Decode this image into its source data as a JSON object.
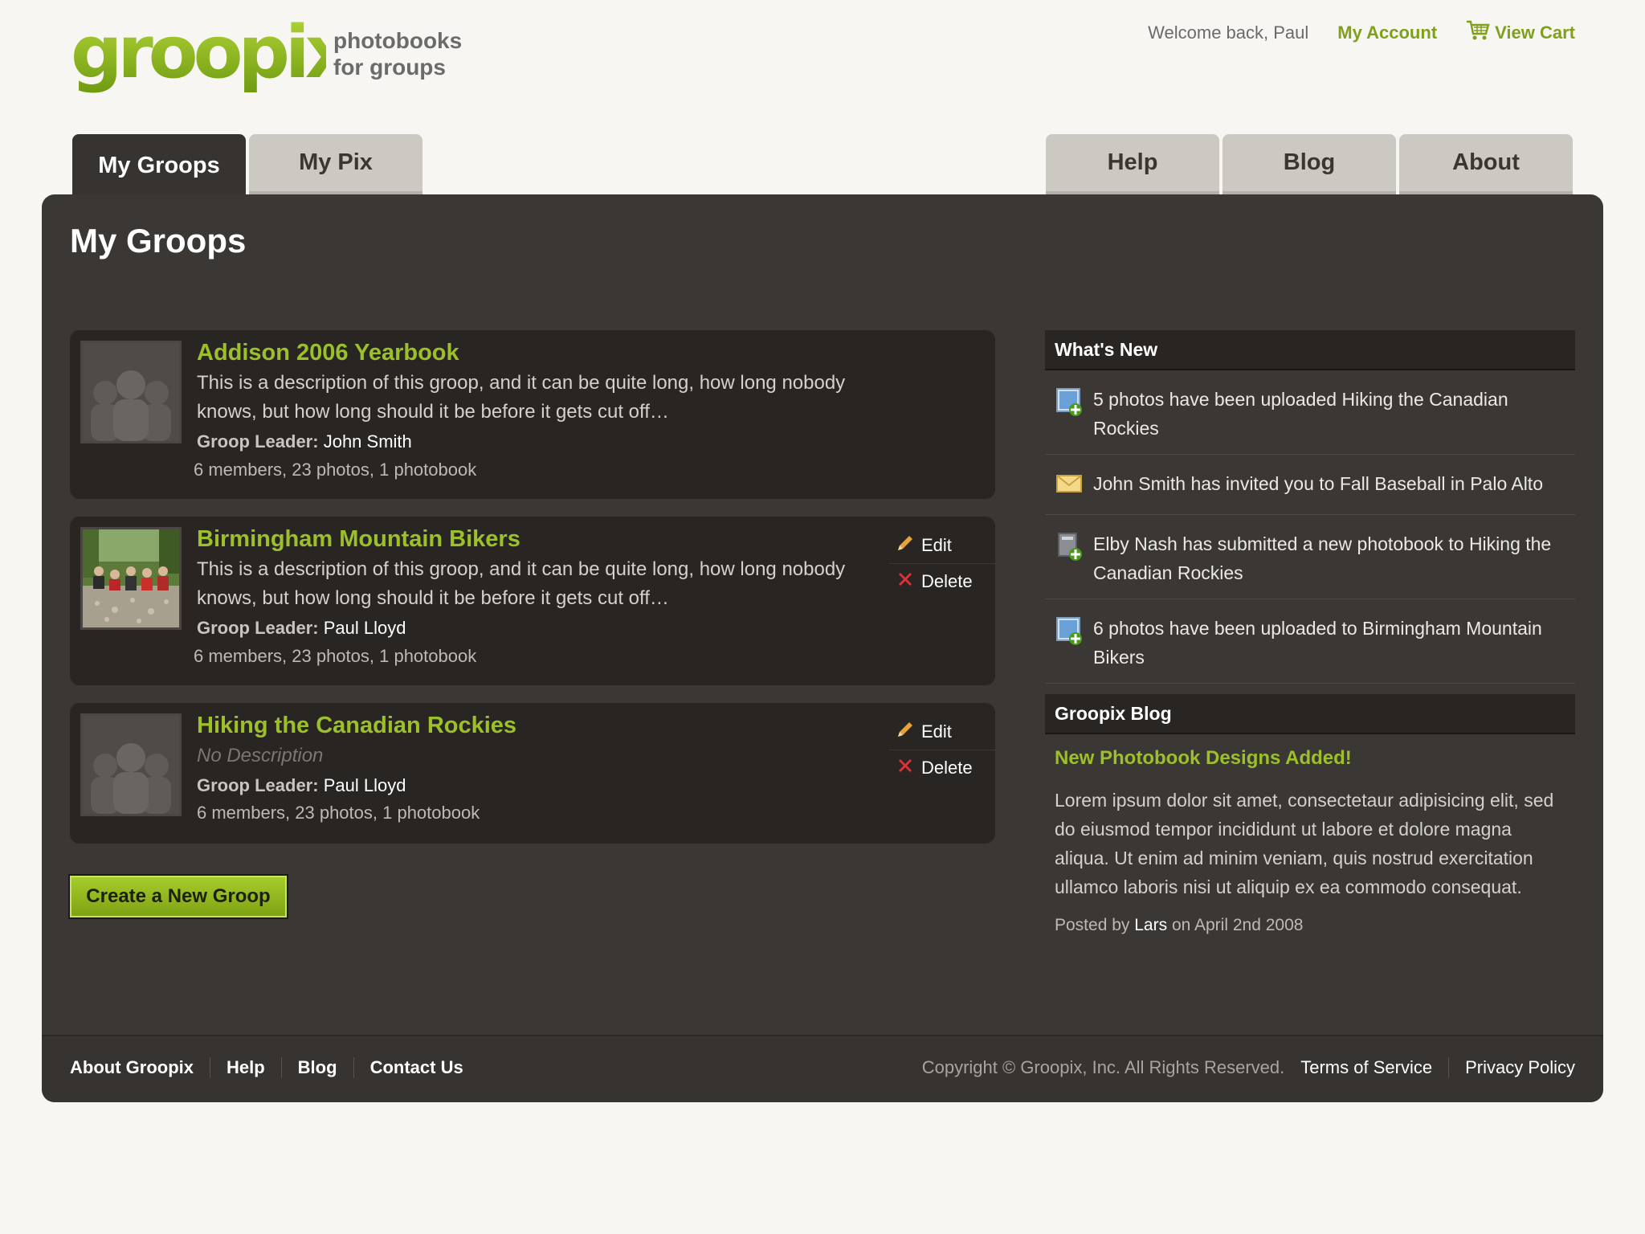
{
  "header": {
    "logo_text": "groopix",
    "tagline_line1": "photobooks",
    "tagline_line2": "for groups",
    "welcome": "Welcome back, Paul",
    "my_account": "My Account",
    "view_cart": "View Cart"
  },
  "tabs": {
    "my_groops": "My Groops",
    "my_pix": "My Pix",
    "help": "Help",
    "blog": "Blog",
    "about": "About"
  },
  "main": {
    "title": "My Groops",
    "groups": [
      {
        "name": "Addison 2006 Yearbook",
        "description": "This is a description of this groop, and it can be quite long, how long nobody knows, but how long should it be before it gets cut off…",
        "leader_label": "Groop Leader:",
        "leader": "John Smith",
        "stats": "6 members, 23 photos, 1 photobook"
      },
      {
        "name": "Birmingham Mountain Bikers",
        "description": "This is a description of this groop, and it can be quite long, how long nobody knows, but how long should it be before it gets cut off…",
        "leader_label": "Groop Leader:",
        "leader": "Paul Lloyd",
        "stats": "6 members, 23 photos, 1 photobook",
        "edit": "Edit",
        "delete": "Delete"
      },
      {
        "name": "Hiking the Canadian Rockies",
        "description": "No Description",
        "leader_label": "Groop Leader:",
        "leader": "Paul Lloyd",
        "stats": "6 members, 23 photos, 1 photobook",
        "edit": "Edit",
        "delete": "Delete"
      }
    ],
    "create_button": "Create a New Groop"
  },
  "sidebar": {
    "whats_new_title": "What's New",
    "news": [
      {
        "icon": "photo-upload-icon",
        "text": "5 photos have been uploaded Hiking the Canadian Rockies"
      },
      {
        "icon": "envelope-icon",
        "text": "John Smith has invited you to Fall Baseball in Palo Alto"
      },
      {
        "icon": "photobook-add-icon",
        "text": "Elby Nash has submitted a new photobook to Hiking the Canadian Rockies"
      },
      {
        "icon": "photo-upload-icon",
        "text": "6 photos have been uploaded to Birmingham Mountain Bikers"
      }
    ],
    "blog_title": "Groopix Blog",
    "blog_post_title": "New Photobook Designs Added!",
    "blog_post_body": "Lorem ipsum dolor sit amet, consectetaur adipisicing elit, sed do eiusmod tempor incididunt ut labore et dolore magna aliqua. Ut enim ad minim veniam, quis nostrud exercitation ullamco laboris nisi ut aliquip ex ea commodo consequat.",
    "posted_by": "Posted by",
    "author": "Lars",
    "posted_on": "on April 2nd 2008"
  },
  "footer": {
    "links": [
      "About Groopix",
      "Help",
      "Blog",
      "Contact Us"
    ],
    "copyright": "Copyright © Groopix, Inc. All Rights Reserved.",
    "terms": "Terms of Service",
    "privacy": "Privacy Policy"
  },
  "colors": {
    "brand_green": "#9cc02a",
    "panel_bg": "#3a3734",
    "card_bg": "#282523",
    "page_bg": "#f8f6f3"
  }
}
